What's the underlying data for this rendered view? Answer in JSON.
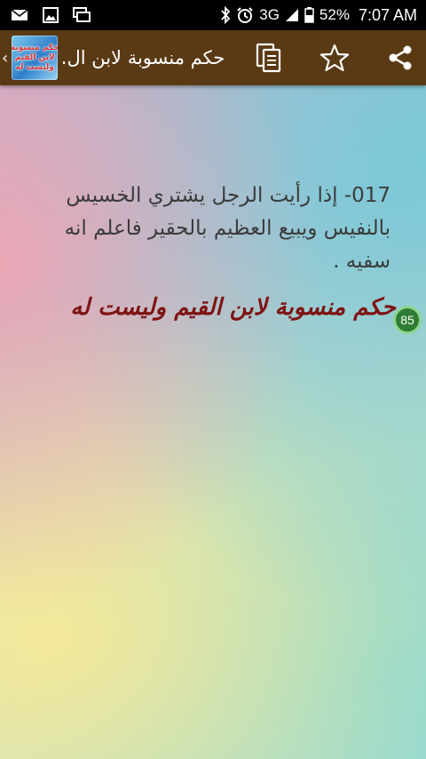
{
  "status_bar": {
    "network": "3G",
    "battery": "52%",
    "time": "7:07 AM",
    "left_icons": [
      "email-icon",
      "image-icon",
      "screen-icon"
    ],
    "right_icons": [
      "bluetooth-icon",
      "alarm-icon",
      "signal-icon",
      "battery-icon"
    ]
  },
  "app_bar": {
    "title": "حكم منسوبة لابن ال.",
    "logo_lines": [
      "حكم منسوبة",
      "لابن القيم",
      "وليست له"
    ],
    "actions": [
      "copy-icon",
      "star-icon",
      "share-icon"
    ],
    "background": "#5a3a14"
  },
  "content": {
    "quote": "017- إذا رأيت الرجل يشتري الخسيس بالنفيس ويبيع العظيم بالحقير فاعلم انه سفيه .",
    "source": "حكم منسوبة لابن القيم وليست له",
    "counter": "85"
  },
  "colors": {
    "quote_text": "#3b3b3b",
    "source_text": "#7e1414",
    "badge": "#2e7d32"
  }
}
